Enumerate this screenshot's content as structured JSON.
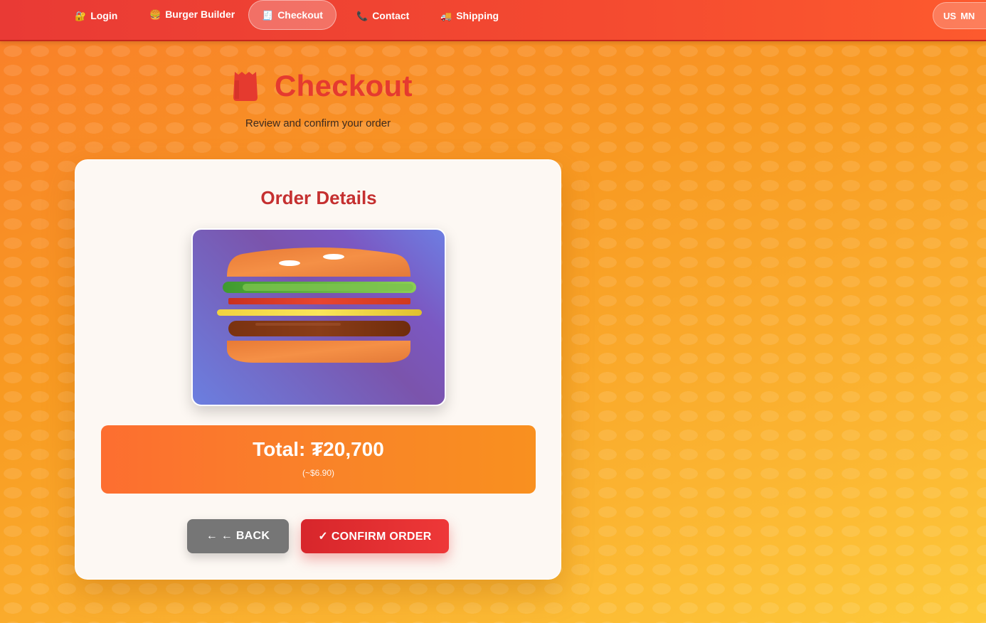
{
  "nav": {
    "items": [
      {
        "icon": "🔐",
        "label": "Login"
      },
      {
        "icon": "🍔",
        "label": "Burger Builder"
      },
      {
        "icon": "🧾",
        "label": "Checkout"
      },
      {
        "icon": "📞",
        "label": "Contact"
      },
      {
        "icon": "🚚",
        "label": "Shipping"
      }
    ],
    "active_index": 2,
    "language": {
      "left": "US",
      "right": "MN"
    }
  },
  "header": {
    "title": "Checkout",
    "subtitle": "Review and confirm your order"
  },
  "order": {
    "heading": "Order Details",
    "total_label": "Total: ₮20,700",
    "total_usd": "(~$6.90)"
  },
  "actions": {
    "back_label": "← ← BACK",
    "confirm_label": "✓ CONFIRM ORDER"
  },
  "colors": {
    "accent": "#e53a2f",
    "nav_bg": "#f44a30",
    "total_bg": "#f98428",
    "back_bg": "#767676",
    "confirm_bg": "#e0302f"
  }
}
